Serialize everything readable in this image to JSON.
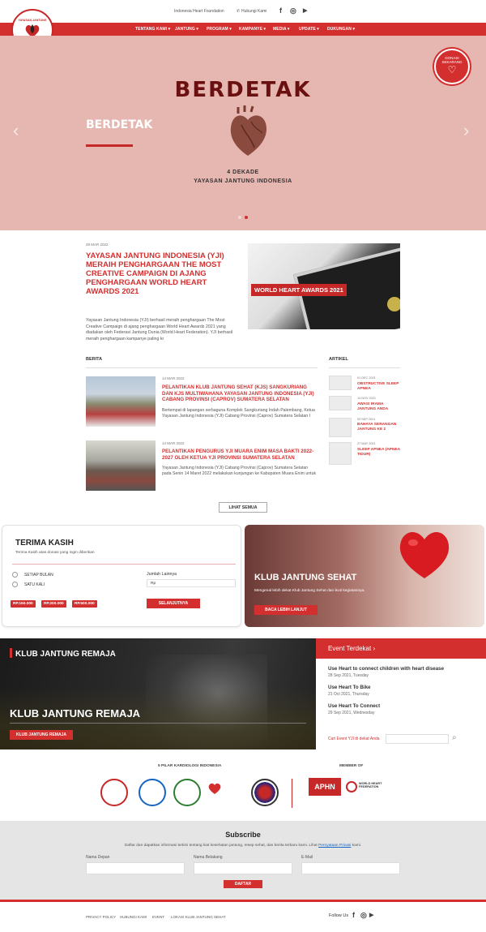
{
  "topbar": {
    "site_name": "Indonesia Heart Foundation",
    "contact": "Hubungi Kami",
    "contact_icon": "phone-icon",
    "social": [
      "f",
      "◎",
      "▶"
    ]
  },
  "logo": {
    "line1": "YAYASAN JANTUNG",
    "line2": "INDONESIA"
  },
  "nav": {
    "items": [
      "TENTANG KAMI",
      "JANTUNG",
      "PROGRAM",
      "KAMPANYE",
      "MEDIA",
      "UPDATE",
      "DUKUNGAN"
    ]
  },
  "hero": {
    "big": "BERDETAK",
    "caption": "BERDETAK",
    "sub1": "4 DEKADE",
    "sub2": "YAYASAN JANTUNG INDONESIA",
    "donasi1": "DONASI",
    "donasi2": "SEKARANG",
    "prev": "‹",
    "next": "›",
    "active_slide": 2,
    "slide_count": 2
  },
  "featured": {
    "date": "28 MAR 2022",
    "title": "YAYASAN JANTUNG INDONESIA (YJI) MERAIH PENGHARGAAN THE MOST CREATIVE CAMPAIGN DI AJANG PENGHARGAAN WORLD HEART AWARDS 2021",
    "desc": "Yayasan Jantung Indonesia (YJI) berhasil meraih penghargaan The Most Creative Campaign di ajang penghargaan World Heart Awards 2021 yang diadakan oleh Federasi Jantung Dunia (World Heart Federation). YJI berhasil meraih penghargaan kampanye paling kr",
    "image_label": "WORLD HEART AWARDS 2021"
  },
  "berita": {
    "heading": "BERITA",
    "items": [
      {
        "date": "14 MAR 2022",
        "title": "PELANTIKAN KLUB JANTUNG SEHAT (KJS) SANGKURIANG DAN KJS MULTIWAHANA YAYASAN JANTUNG INDONESIA (YJI) CABANG PROVINSI (CAPROV) SUMATERA SELATAN",
        "desc": "Bertempat di lapangan serbaguna Komplek Sangkuriang Indah Palembang, Ketua Yayasan Jantung Indonesia (YJI) Cabang Provinsi (Caprov) Sumatera Selatan I"
      },
      {
        "date": "14 MAR 2022",
        "title": "PELANTIKAN PENGURUS YJI MUARA ENIM MASA BAKTI 2022-2027 OLEH KETUA YJI PROVINSI SUMATERA SELATAN",
        "desc": "Yayasan Jantung Indonesia (YJI) Cabang Provinsi (Caprov) Sumatera Selatan pada Senin 14 Maret 2022 melakukan kunjungan ke Kabupaten Muara Enim untuk"
      }
    ]
  },
  "artikel": {
    "heading": "ARTIKEL",
    "items": [
      {
        "date": "01 DEC 2021",
        "title": "OBSTRUCTIVE SLEEP APNEA"
      },
      {
        "date": "14 NOV 2021",
        "title": "AWASI IRAMA JANTUNG ANDA"
      },
      {
        "date": "09 SEP 2021",
        "title": "BAHAYA SERANGAN JANTUNG KE 2"
      },
      {
        "date": "27 MAY 2021",
        "title": "SLEEP APNEA (APNEA TIDUR)"
      }
    ]
  },
  "lihat_semua": "LIHAT SEMUA",
  "donate": {
    "title": "TERIMA KASIH",
    "subtitle": "Terima Kasih atas donasi yang ingin diberikan",
    "opt1": "SETIAP BULAN",
    "opt2": "SATU KALI",
    "other_label": "Jumlah Lainnya",
    "currency": "Rp",
    "amounts": [
      "RP.150.000",
      "RP.200.000",
      "RP.500.000"
    ],
    "submit": "SELANJUTNYA"
  },
  "klub_sehat": {
    "title": "KLUB JANTUNG SEHAT",
    "desc": "Mengenal lebih dekat Klub Jantung Sehat dan ikuti kegiatannya.",
    "button": "BACA LEBIH LANJUT"
  },
  "remaja": {
    "title_top": "KLUB JANTUNG REMAJA",
    "title_big": "KLUB JANTUNG REMAJA",
    "button": "KLUB JANTUNG REMAJA"
  },
  "events": {
    "heading": "Event Terdekat",
    "chevron": "›",
    "items": [
      {
        "title": "Use Heart to connect children with heart disease",
        "date": "28 Sep 2021, Tuesday"
      },
      {
        "title": "Use Heart To Bike",
        "date": "21 Oct 2021, Thursday"
      },
      {
        "title": "Use Heart To Connect",
        "date": "29 Sep 2021, Wednesday"
      }
    ],
    "search_label": "Cari Event YJI di dekat Anda"
  },
  "partners": {
    "pillar_heading": "5 PILAR KARDIOLOGI INDONESIA",
    "member_heading": "MEMBER OF",
    "member1": "APHN",
    "member2": "WORLD HEART FEDERATION"
  },
  "subscribe": {
    "title": "Subscribe",
    "desc": "Daftar dan dapatkan informasi terkini tentang kiat kesehatan jantung, resep sehat, dan berita terbaru kami. Lihat",
    "link": "Pernyataan Privasi",
    "desc_end": "kami.",
    "first_name": "Nama Depan",
    "last_name": "Nama Belakang",
    "email": "E-Mail",
    "button": "DAFTAR"
  },
  "footer": {
    "links": [
      "PRIVACY POLICY",
      "HUBUNGI KAMI",
      "EVENT",
      "LOKASI KLUB JANTUNG SEHAT"
    ],
    "follow": "Follow Us"
  },
  "colors": {
    "brand_red": "#d32f2f",
    "hero_bg": "#e6b6b0"
  }
}
